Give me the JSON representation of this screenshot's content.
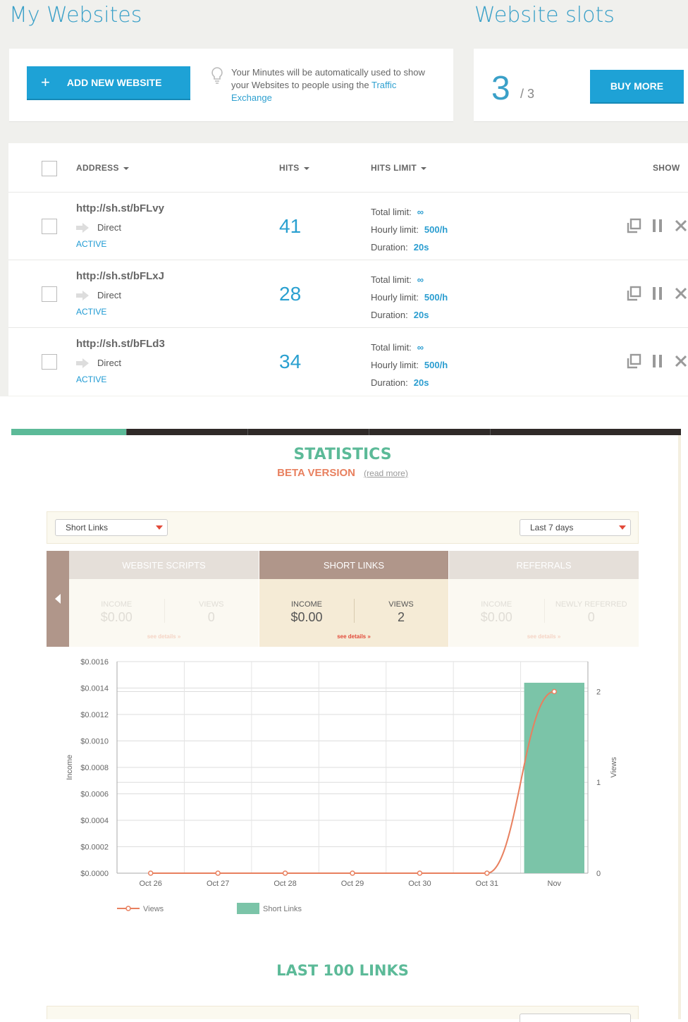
{
  "header": {
    "title": "My Websites",
    "slots_title": "Website slots"
  },
  "add_button": {
    "icon": "plus-icon",
    "label": "ADD NEW WEBSITE"
  },
  "tip": {
    "text": "Your Minutes will be automatically used to show your Websites to people using the ",
    "link": "Traffic Exchange"
  },
  "slots": {
    "used": "3",
    "total": "/ 3",
    "buy_label": "BUY MORE"
  },
  "table": {
    "columns": [
      "ADDRESS",
      "HITS",
      "HITS LIMIT",
      "SHOW"
    ],
    "limit_labels": {
      "total": "Total limit:",
      "hourly": "Hourly limit:",
      "duration": "Duration:"
    },
    "rows": [
      {
        "address": "http://sh.st/bFLvy",
        "source": "Direct",
        "status": "ACTIVE",
        "hits": "41",
        "total_limit": "∞",
        "hourly_limit": "500/h",
        "duration": "20s"
      },
      {
        "address": "http://sh.st/bFLxJ",
        "source": "Direct",
        "status": "ACTIVE",
        "hits": "28",
        "total_limit": "∞",
        "hourly_limit": "500/h",
        "duration": "20s"
      },
      {
        "address": "http://sh.st/bFLd3",
        "source": "Direct",
        "status": "ACTIVE",
        "hits": "34",
        "total_limit": "∞",
        "hourly_limit": "500/h",
        "duration": "20s"
      }
    ]
  },
  "statistics": {
    "title": "STATISTICS",
    "beta": "BETA VERSION",
    "read_more": "(read more)",
    "filter_type": "Short Links",
    "filter_range": "Last 7 days",
    "panels": [
      {
        "tab": "WEBSITE SCRIPTS",
        "m1_label": "INCOME",
        "m1_value": "$0.00",
        "m2_label": "VIEWS",
        "m2_value": "0",
        "details": "see details »"
      },
      {
        "tab": "SHORT LINKS",
        "m1_label": "INCOME",
        "m1_value": "$0.00",
        "m2_label": "VIEWS",
        "m2_value": "2",
        "details": "see details »"
      },
      {
        "tab": "REFERRALS",
        "m1_label": "INCOME",
        "m1_value": "$0.00",
        "m2_label": "NEWLY REFERRED",
        "m2_value": "0",
        "details": "see details »"
      }
    ],
    "last_links_title": "LAST 100 LINKS"
  },
  "colors": {
    "accent_blue": "#1ea2d6",
    "teal": "#5cba98",
    "salmon": "#e8805f",
    "bar": "#7bc4a8"
  },
  "chart_data": {
    "type": "bar",
    "categories": [
      "Oct 26",
      "Oct 27",
      "Oct 28",
      "Oct 29",
      "Oct 30",
      "Oct 31",
      "Nov"
    ],
    "ylabel": "Income",
    "y2label": "Views",
    "ylim": [
      0,
      0.0016
    ],
    "y2lim": [
      0,
      2.33
    ],
    "yticks": [
      "$0.0000",
      "$0.0002",
      "$0.0004",
      "$0.0006",
      "$0.0008",
      "$0.0010",
      "$0.0012",
      "$0.0014",
      "$0.0016"
    ],
    "y2ticks": [
      "0",
      "1",
      "2"
    ],
    "series": [
      {
        "name": "Short Links",
        "type": "bar",
        "axis": "income",
        "values": [
          0,
          0,
          0,
          0,
          0,
          0,
          0.00144
        ]
      },
      {
        "name": "Views",
        "type": "line",
        "axis": "views",
        "values": [
          0,
          0,
          0,
          0,
          0,
          0,
          2
        ]
      }
    ],
    "legend": "bottom-left",
    "grid": true
  }
}
